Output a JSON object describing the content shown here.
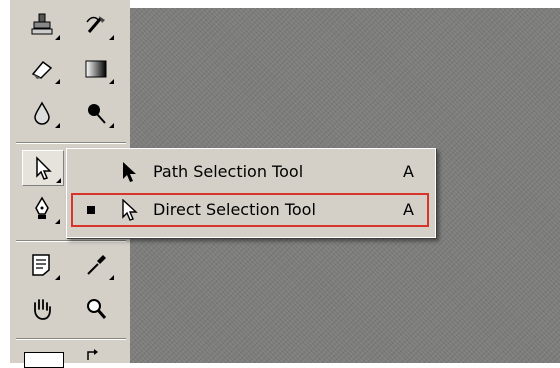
{
  "toolbox": {
    "tools": [
      {
        "name": "clone-stamp-tool",
        "icon": "stamp-icon"
      },
      {
        "name": "history-brush-tool",
        "icon": "history-brush-icon"
      },
      {
        "name": "eraser-tool",
        "icon": "eraser-icon"
      },
      {
        "name": "gradient-tool",
        "icon": "gradient-icon"
      },
      {
        "name": "blur-tool",
        "icon": "drop-icon"
      },
      {
        "name": "burn-tool",
        "icon": "burn-icon"
      },
      {
        "name": "selection-tool",
        "icon": "arrow-icon"
      },
      {
        "name": "pen-tool",
        "icon": "pen-icon"
      },
      {
        "name": "notes-tool",
        "icon": "notes-icon"
      },
      {
        "name": "eyedropper-tool",
        "icon": "eyedropper-icon"
      },
      {
        "name": "hand-tool",
        "icon": "hand-icon"
      },
      {
        "name": "zoom-tool",
        "icon": "magnifier-icon"
      }
    ]
  },
  "flyout": {
    "items": [
      {
        "label": "Path Selection Tool",
        "shortcut": "A",
        "icon": "black-arrow-icon",
        "checked": false
      },
      {
        "label": "Direct Selection Tool",
        "shortcut": "A",
        "icon": "white-arrow-icon",
        "checked": true
      }
    ]
  },
  "colors": {
    "canvas": "#7d7d7c",
    "toolbox": "#d4d0c8",
    "highlight": "#d9342b"
  }
}
